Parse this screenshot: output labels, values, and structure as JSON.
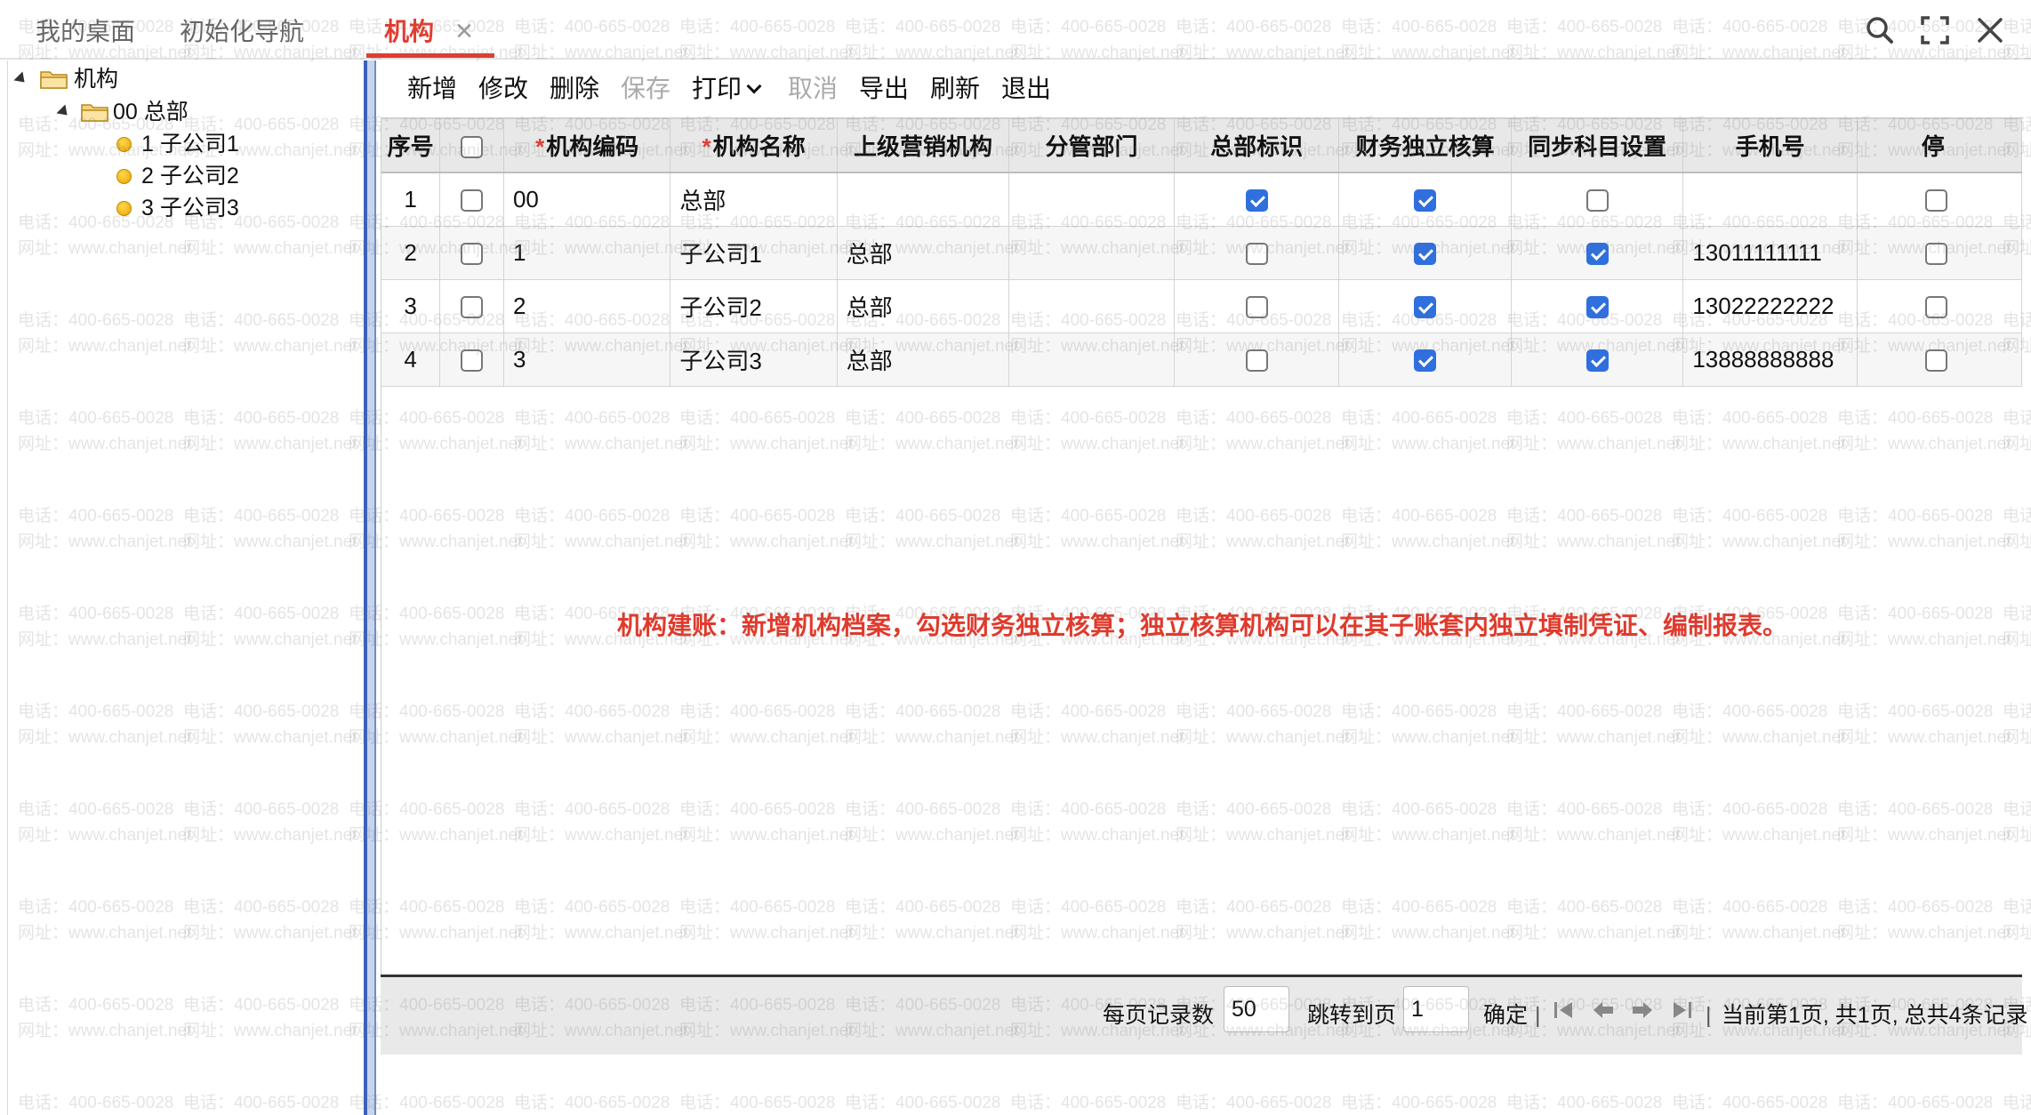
{
  "tabs": [
    {
      "label": "我的桌面",
      "active": false
    },
    {
      "label": "初始化导航",
      "active": false
    },
    {
      "label": "机构",
      "active": true
    }
  ],
  "top_icons": [
    "search-icon",
    "fullscreen-icon",
    "close-icon"
  ],
  "tree": {
    "root": "机构",
    "headquarters": "00 总部",
    "children": [
      "1 子公司1",
      "2 子公司2",
      "3 子公司3"
    ]
  },
  "toolbar": [
    {
      "label": "新增",
      "enabled": true
    },
    {
      "label": "修改",
      "enabled": true
    },
    {
      "label": "删除",
      "enabled": true
    },
    {
      "label": "保存",
      "enabled": false
    },
    {
      "label": "打印",
      "enabled": true,
      "dropdown": true
    },
    {
      "label": "取消",
      "enabled": false
    },
    {
      "label": "导出",
      "enabled": true
    },
    {
      "label": "刷新",
      "enabled": true
    },
    {
      "label": "退出",
      "enabled": true
    }
  ],
  "table": {
    "columns": [
      "序号",
      "",
      "机构编码",
      "机构名称",
      "上级营销机构",
      "分管部门",
      "总部标识",
      "财务独立核算",
      "同步科目设置",
      "手机号",
      "停"
    ],
    "required_mark": "*",
    "rows": [
      {
        "seq": "1",
        "code": "00",
        "name": "总部",
        "parent": "",
        "dept": "",
        "hq": true,
        "indep": true,
        "sync": false,
        "phone": ""
      },
      {
        "seq": "2",
        "code": "1",
        "name": "子公司1",
        "parent": "总部",
        "dept": "",
        "hq": false,
        "indep": true,
        "sync": true,
        "phone": "13011111111"
      },
      {
        "seq": "3",
        "code": "2",
        "name": "子公司2",
        "parent": "总部",
        "dept": "",
        "hq": false,
        "indep": true,
        "sync": true,
        "phone": "13022222222"
      },
      {
        "seq": "4",
        "code": "3",
        "name": "子公司3",
        "parent": "总部",
        "dept": "",
        "hq": false,
        "indep": true,
        "sync": true,
        "phone": "13888888888"
      }
    ]
  },
  "note": "机构建账：新增机构档案，勾选财务独立核算；独立核算机构可以在其子账套内独立填制凭证、编制报表。",
  "pager": {
    "per_page_label": "每页记录数",
    "per_page_value": "50",
    "jump_label": "跳转到页",
    "jump_value": "1",
    "confirm": "确定",
    "sep": "|",
    "summary": "当前第1页, 共1页, 总共4条记录"
  },
  "watermark": {
    "line1": "电话：400-665-0028",
    "line2": "网址：www.chanjet.net"
  },
  "colors": {
    "accent": "#e33b2f",
    "checkbox": "#2f6fde",
    "splitter": "#3a63b8"
  }
}
